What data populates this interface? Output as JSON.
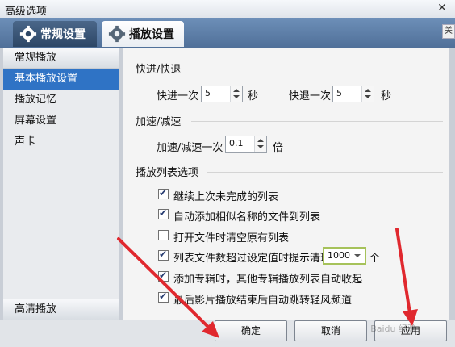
{
  "window": {
    "title": "高级选项",
    "close_glyph": "✕"
  },
  "tabs": [
    {
      "label": "常规设置",
      "icon": "gear-icon",
      "active": false
    },
    {
      "label": "播放设置",
      "icon": "gear-icon",
      "active": true
    }
  ],
  "peek_label": "关",
  "sidebar": {
    "category_top": "常规播放",
    "items": [
      {
        "label": "基本播放设置",
        "selected": true
      },
      {
        "label": "播放记忆",
        "selected": false
      },
      {
        "label": "屏幕设置",
        "selected": false
      },
      {
        "label": "声卡",
        "selected": false
      }
    ],
    "category_bottom": "高清播放"
  },
  "seek": {
    "title": "快进/快退",
    "forward_label": "快进一次",
    "forward_value": "5",
    "forward_unit": "秒",
    "backward_label": "快退一次",
    "backward_value": "5",
    "backward_unit": "秒"
  },
  "speed": {
    "title": "加速/减速",
    "label": "加速/减速一次",
    "value": "0.1",
    "unit": "倍"
  },
  "playlist": {
    "title": "播放列表选项",
    "options": [
      {
        "label": "继续上次未完成的列表",
        "checked": true
      },
      {
        "label": "自动添加相似名称的文件到列表",
        "checked": true
      },
      {
        "label": "打开文件时清空原有列表",
        "checked": false
      },
      {
        "label": "列表文件数超过设定值时提示清理",
        "checked": true
      },
      {
        "label": "添加专辑时，其他专辑播放列表自动收起",
        "checked": true
      },
      {
        "label": "最后影片播放结束后自动跳转轻风频道",
        "checked": true
      }
    ],
    "threshold_value": "1000",
    "threshold_unit": "个"
  },
  "buttons": {
    "ok": "确定",
    "cancel": "取消",
    "apply": "应用"
  },
  "watermark": "Baidu 经验",
  "colors": {
    "selection": "#2f73c5",
    "annotation_arrow": "#e0282e"
  }
}
